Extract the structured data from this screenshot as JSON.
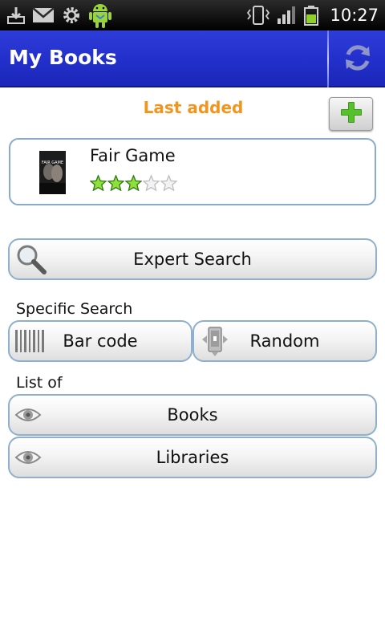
{
  "status_bar": {
    "time": "10:27",
    "icons_left": [
      "download-icon",
      "gmail-icon",
      "settings-icon",
      "android-icon"
    ],
    "icons_right": [
      "vibrate-icon",
      "signal-icon",
      "battery-icon"
    ]
  },
  "header": {
    "title": "My Books",
    "refresh_icon": "refresh-icon",
    "color": "#2330cc"
  },
  "last_added": {
    "label": "Last added",
    "label_color": "#f0951e",
    "add_icon": "plus-icon",
    "book": {
      "title": "Fair Game",
      "cover_text": "FAIR GAME",
      "rating": 3,
      "max_rating": 5
    }
  },
  "expert_search": {
    "label": "Expert Search",
    "icon": "magnifier-icon"
  },
  "specific_search": {
    "label": "Specific Search",
    "barcode": {
      "label": "Bar code",
      "icon": "barcode-icon"
    },
    "random": {
      "label": "Random",
      "icon": "random-device-icon"
    }
  },
  "list_of": {
    "label": "List of",
    "books": {
      "label": "Books",
      "icon": "eye-icon"
    },
    "libraries": {
      "label": "Libraries",
      "icon": "eye-icon"
    }
  }
}
